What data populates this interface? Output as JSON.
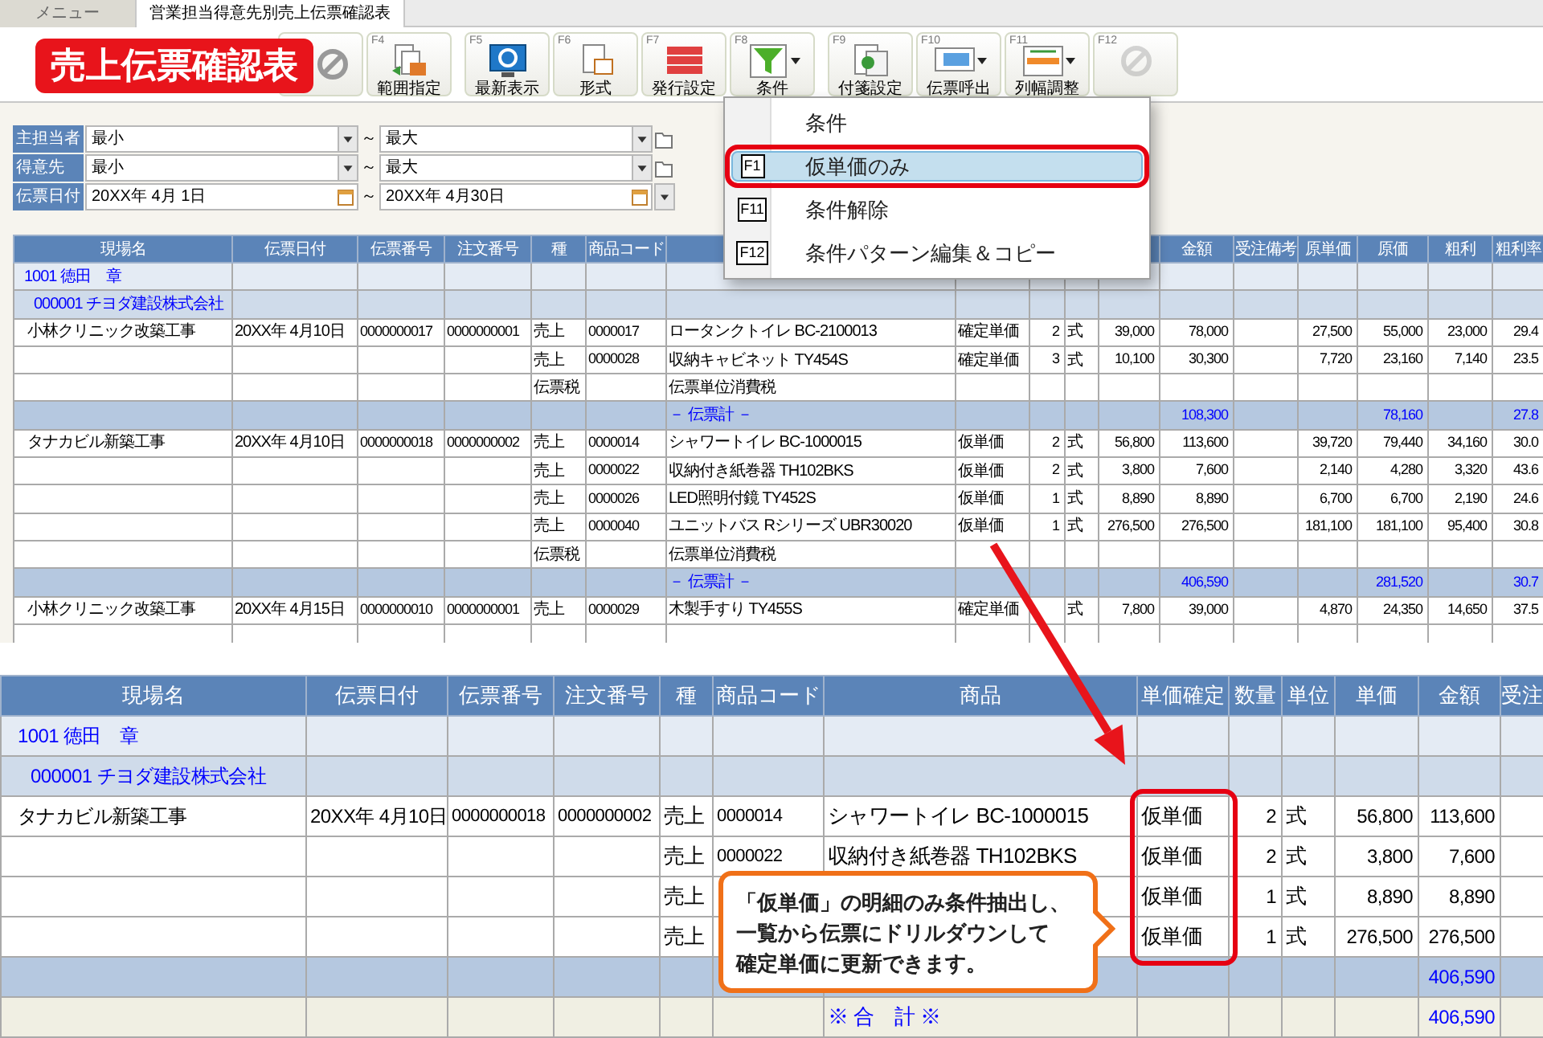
{
  "tabs": [
    {
      "label": "メニュー",
      "selected": false
    },
    {
      "label": "営業担当得意先別売上伝票確認表",
      "selected": true
    }
  ],
  "title_banner": "売上伝票確認表",
  "toolbar": [
    {
      "key": "F4",
      "label": "範囲指定",
      "dropdown": false,
      "disabled": false
    },
    {
      "key": "F5",
      "label": "最新表示",
      "dropdown": false,
      "disabled": false
    },
    {
      "key": "F6",
      "label": "形式",
      "dropdown": false,
      "disabled": false
    },
    {
      "key": "F7",
      "label": "発行設定",
      "dropdown": false,
      "disabled": false
    },
    {
      "key": "F8",
      "label": "条件",
      "dropdown": true,
      "disabled": false
    },
    {
      "key": "F9",
      "label": "付箋設定",
      "dropdown": false,
      "disabled": false
    },
    {
      "key": "F10",
      "label": "伝票呼出",
      "dropdown": true,
      "disabled": false
    },
    {
      "key": "F11",
      "label": "列幅調整",
      "dropdown": true,
      "disabled": false
    },
    {
      "key": "F12",
      "dropdown": false,
      "disabled": true
    }
  ],
  "filters": [
    {
      "kind": "select",
      "label": "主担当者",
      "from": "最小",
      "separator": "～",
      "to": "最大"
    },
    {
      "kind": "select",
      "label": "得意先",
      "from": "最小",
      "separator": "～",
      "to": "最大"
    },
    {
      "kind": "date",
      "label": "伝票日付",
      "from": "20XX年 4月 1日",
      "separator": "～",
      "to": "20XX年 4月30日"
    }
  ],
  "menu": [
    {
      "label": "条件",
      "selected": false
    },
    {
      "key": "F1",
      "label": "仮単価のみ",
      "selected": true
    },
    {
      "key": "F11",
      "label": "条件解除",
      "selected": false
    },
    {
      "key": "F12",
      "label": "条件パターン編集＆コピー",
      "selected": false
    }
  ],
  "top_table": {
    "columns": [
      "現場名",
      "伝票日付",
      "伝票番号",
      "注文番号",
      "種",
      "商品コード",
      null,
      null,
      null,
      null,
      null,
      "金額",
      "受注備考",
      "原単価",
      "原価",
      "粗利",
      "粗利率"
    ],
    "rows": [
      {
        "kind": "staff",
        "cells": [
          "1001 徳田　章",
          null,
          null,
          null,
          null,
          null,
          null,
          null,
          null,
          null,
          null,
          null,
          null,
          null,
          null,
          null,
          null
        ]
      },
      {
        "kind": "customer",
        "cells": [
          "000001 チヨダ建設株式会社",
          null,
          null,
          null,
          null,
          null,
          null,
          null,
          null,
          null,
          null,
          null,
          null,
          null,
          null,
          null,
          null
        ]
      },
      {
        "kind": "detail",
        "cells": [
          "小林クリニック改築工事",
          "20XX年 4月10日",
          "0000000017",
          "0000000001",
          "売上",
          "0000017",
          "ロータンクトイレ BC-2100013",
          "確定単価",
          "2",
          "式",
          "39,000",
          "78,000",
          null,
          "27,500",
          "55,000",
          "23,000",
          "29.4"
        ]
      },
      {
        "kind": "detail",
        "cells": [
          null,
          null,
          null,
          null,
          "売上",
          "0000028",
          "収納キャビネット TY454S",
          "確定単価",
          "3",
          "式",
          "10,100",
          "30,300",
          null,
          "7,720",
          "23,160",
          "7,140",
          "23.5"
        ]
      },
      {
        "kind": "detail",
        "cells": [
          null,
          null,
          null,
          null,
          "伝票税",
          null,
          "伝票単位消費税",
          null,
          null,
          null,
          null,
          null,
          null,
          null,
          null,
          null,
          null
        ]
      },
      {
        "kind": "subtotal",
        "cells": [
          null,
          null,
          null,
          null,
          null,
          null,
          "－ 伝票計 －",
          null,
          null,
          null,
          null,
          "108,300",
          null,
          null,
          "78,160",
          null,
          "27.8"
        ]
      },
      {
        "kind": "detail",
        "cells": [
          "タナカビル新築工事",
          "20XX年 4月10日",
          "0000000018",
          "0000000002",
          "売上",
          "0000014",
          "シャワートイレ BC-1000015",
          "仮単価",
          "2",
          "式",
          "56,800",
          "113,600",
          null,
          "39,720",
          "79,440",
          "34,160",
          "30.0"
        ]
      },
      {
        "kind": "detail",
        "cells": [
          null,
          null,
          null,
          null,
          "売上",
          "0000022",
          "収納付き紙巻器 TH102BKS",
          "仮単価",
          "2",
          "式",
          "3,800",
          "7,600",
          null,
          "2,140",
          "4,280",
          "3,320",
          "43.6"
        ]
      },
      {
        "kind": "detail",
        "cells": [
          null,
          null,
          null,
          null,
          "売上",
          "0000026",
          "LED照明付鏡 TY452S",
          "仮単価",
          "1",
          "式",
          "8,890",
          "8,890",
          null,
          "6,700",
          "6,700",
          "2,190",
          "24.6"
        ]
      },
      {
        "kind": "detail",
        "cells": [
          null,
          null,
          null,
          null,
          "売上",
          "0000040",
          "ユニットバス Rシリーズ UBR30020",
          "仮単価",
          "1",
          "式",
          "276,500",
          "276,500",
          null,
          "181,100",
          "181,100",
          "95,400",
          "30.8"
        ]
      },
      {
        "kind": "detail",
        "cells": [
          null,
          null,
          null,
          null,
          "伝票税",
          null,
          "伝票単位消費税",
          null,
          null,
          null,
          null,
          null,
          null,
          null,
          null,
          null,
          null
        ]
      },
      {
        "kind": "subtotal",
        "cells": [
          null,
          null,
          null,
          null,
          null,
          null,
          "－ 伝票計 －",
          null,
          null,
          null,
          null,
          "406,590",
          null,
          null,
          "281,520",
          null,
          "30.7"
        ]
      },
      {
        "kind": "detail",
        "cells": [
          "小林クリニック改築工事",
          "20XX年 4月15日",
          "0000000010",
          "0000000001",
          "売上",
          "0000029",
          "木製手すり TY455S",
          "確定単価",
          null,
          "式",
          "7,800",
          "39,000",
          null,
          "4,870",
          "24,350",
          "14,650",
          "37.5"
        ]
      },
      {
        "kind": "detail",
        "cells": [
          null,
          null,
          null,
          null,
          null,
          null,
          null,
          null,
          null,
          null,
          null,
          null,
          null,
          null,
          null,
          null,
          null
        ]
      }
    ]
  },
  "bottom_table": {
    "columns": [
      "現場名",
      "伝票日付",
      "伝票番号",
      "注文番号",
      "種",
      "商品コード",
      "商品",
      "単価確定",
      "数量",
      "単位",
      "単価",
      "金額",
      "受注"
    ],
    "rows": [
      {
        "kind": "staff",
        "cells": [
          "1001 徳田　章",
          null,
          null,
          null,
          null,
          null,
          null,
          null,
          null,
          null,
          null,
          null,
          null
        ]
      },
      {
        "kind": "customer",
        "cells": [
          "000001 チヨダ建設株式会社",
          null,
          null,
          null,
          null,
          null,
          null,
          null,
          null,
          null,
          null,
          null,
          null
        ]
      },
      {
        "kind": "detail",
        "cells": [
          "タナカビル新築工事",
          "20XX年 4月10日",
          "0000000018",
          "0000000002",
          "売上",
          "0000014",
          "シャワートイレ BC-1000015",
          "仮単価",
          "2",
          "式",
          "56,800",
          "113,600",
          null
        ]
      },
      {
        "kind": "detail",
        "cells": [
          null,
          null,
          null,
          null,
          "売上",
          "0000022",
          "収納付き紙巻器 TH102BKS",
          "仮単価",
          "2",
          "式",
          "3,800",
          "7,600",
          null
        ]
      },
      {
        "kind": "detail",
        "cells": [
          null,
          null,
          null,
          null,
          "売上",
          null,
          null,
          "仮単価",
          "1",
          "式",
          "8,890",
          "8,890",
          null
        ]
      },
      {
        "kind": "detail",
        "cells": [
          null,
          null,
          null,
          null,
          "売上",
          null,
          null,
          "仮単価",
          "1",
          "式",
          "276,500",
          "276,500",
          null
        ]
      },
      {
        "kind": "subtotal",
        "cells": [
          null,
          null,
          null,
          null,
          null,
          null,
          null,
          null,
          null,
          null,
          null,
          "406,590",
          null
        ]
      },
      {
        "kind": "total",
        "cells": [
          null,
          null,
          null,
          null,
          null,
          null,
          "※ 合　計 ※",
          null,
          null,
          null,
          null,
          "406,590",
          null
        ]
      }
    ]
  },
  "callout": {
    "lines": [
      "「仮単価」の明細のみ条件抽出し、",
      "一覧から伝票にドリルダウンして",
      "確定単価に更新できます。"
    ]
  }
}
